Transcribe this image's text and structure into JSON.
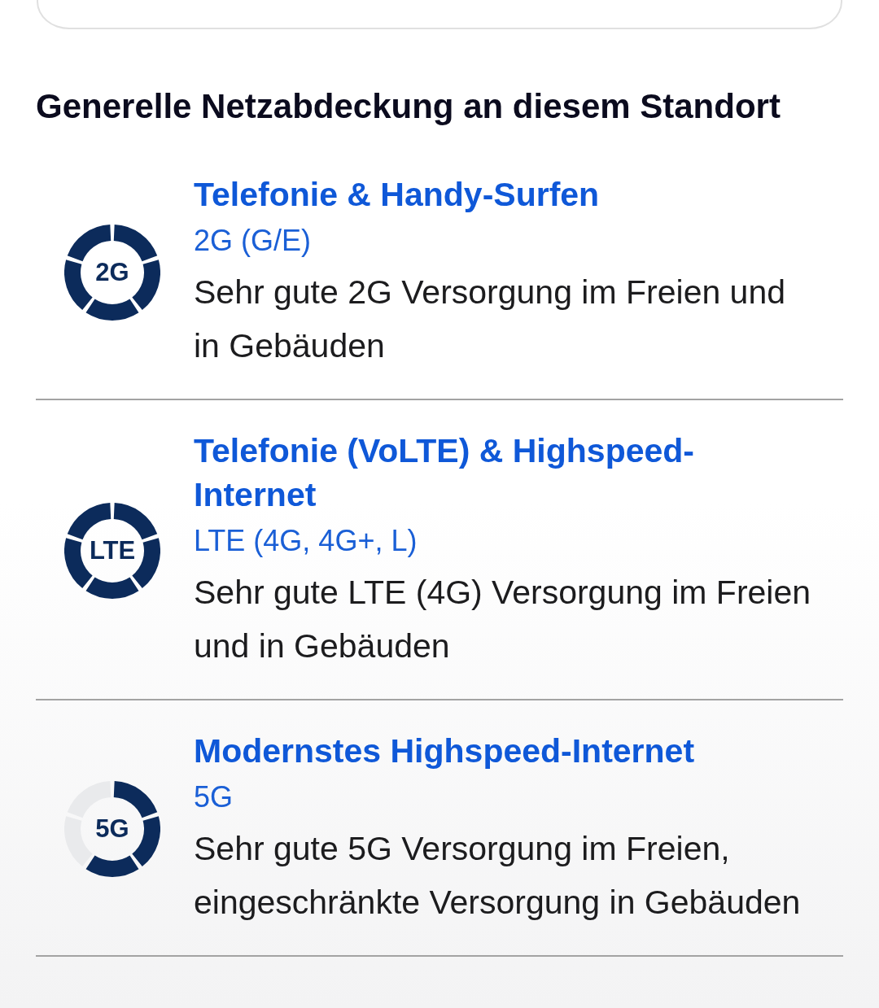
{
  "heading": "Generelle Netzabdeckung an diesem Standort",
  "networks": [
    {
      "badge": "2G",
      "segments": [
        {
          "filled": true
        },
        {
          "filled": true
        },
        {
          "filled": true
        },
        {
          "filled": true
        },
        {
          "filled": true
        }
      ],
      "title": "Telefonie & Handy-Surfen",
      "technology": "2G (G/E)",
      "description": "Sehr gute 2G Versorgung im Freien und in Gebäuden"
    },
    {
      "badge": "LTE",
      "segments": [
        {
          "filled": true
        },
        {
          "filled": true
        },
        {
          "filled": true
        },
        {
          "filled": true
        },
        {
          "filled": true
        }
      ],
      "title": "Telefonie (VoLTE) & Highspeed-Internet",
      "technology": "LTE (4G, 4G+, L)",
      "description": "Sehr gute LTE (4G) Versorgung im Freien und in Gebäuden"
    },
    {
      "badge": "5G",
      "segments": [
        {
          "filled": true
        },
        {
          "filled": true
        },
        {
          "filled": true
        },
        {
          "filled": false
        },
        {
          "filled": false
        }
      ],
      "title": "Modernstes Highspeed-Internet",
      "technology": "5G",
      "description": "Sehr gute 5G Versorgung im Freien, eingeschränkte Versorgung in Gebäuden"
    }
  ]
}
